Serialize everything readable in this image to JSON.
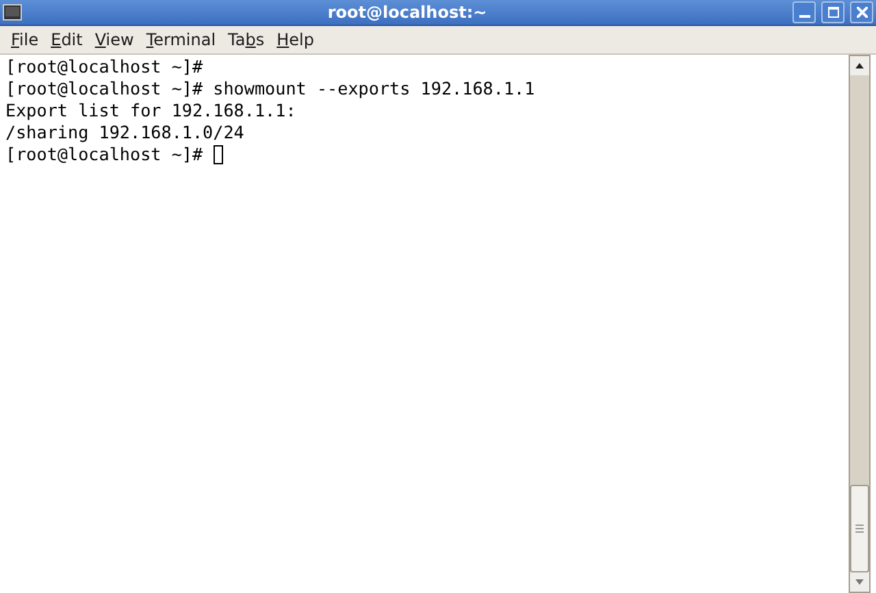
{
  "window": {
    "title": "root@localhost:~"
  },
  "menu": [
    {
      "key": "F",
      "post": "ile"
    },
    {
      "key": "E",
      "post": "dit"
    },
    {
      "key": "V",
      "post": "iew"
    },
    {
      "key": "T",
      "post": "erminal"
    },
    {
      "pre": "Ta",
      "key": "b",
      "post": "s"
    },
    {
      "key": "H",
      "post": "elp"
    }
  ],
  "terminal": {
    "lines": [
      "[root@localhost ~]#",
      "[root@localhost ~]# showmount --exports 192.168.1.1",
      "Export list for 192.168.1.1:",
      "/sharing 192.168.1.0/24",
      "[root@localhost ~]# "
    ],
    "cursor": true
  }
}
